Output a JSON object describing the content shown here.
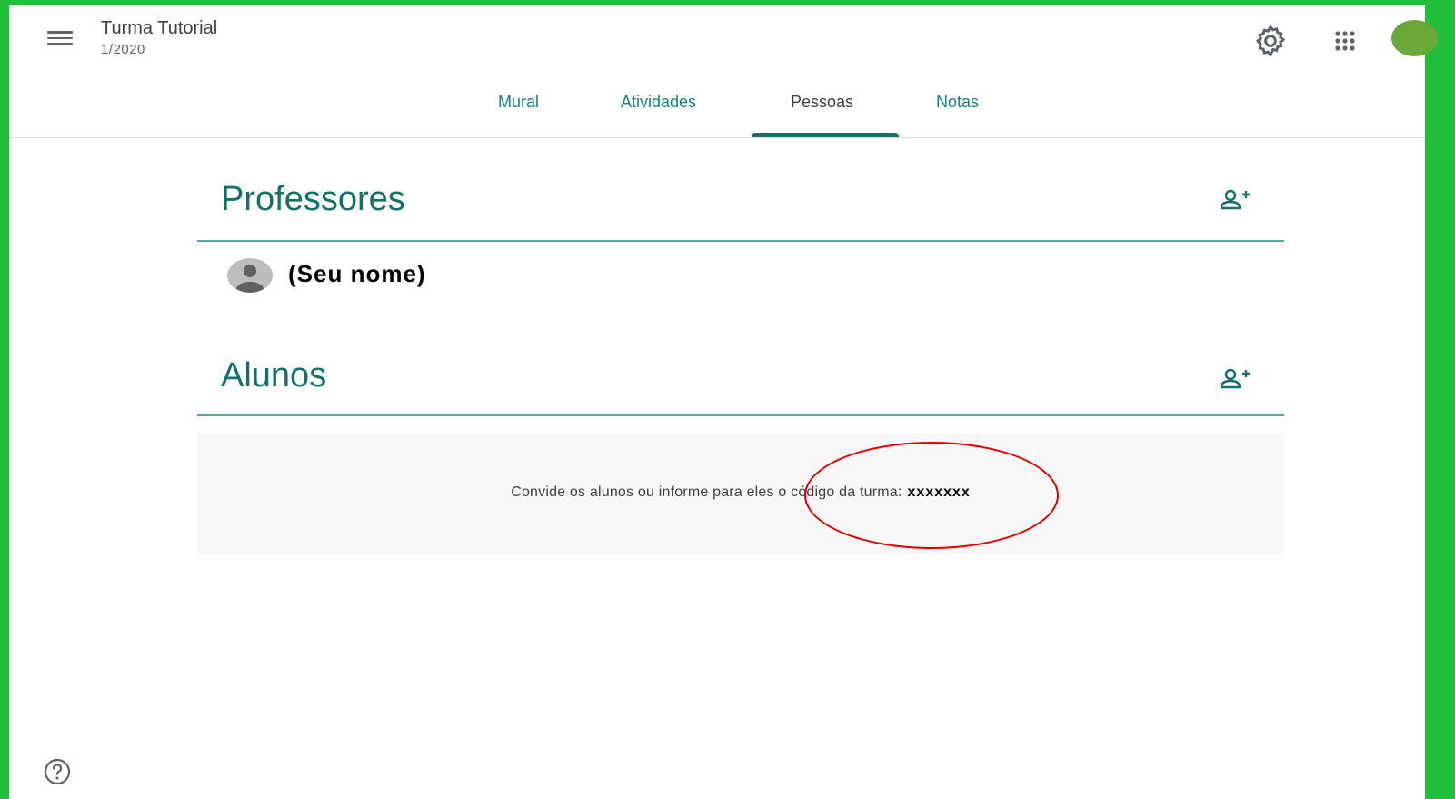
{
  "header": {
    "class_name": "Turma Tutorial",
    "class_period": "1/2020",
    "icons": {
      "menu": "hamburger-menu-icon",
      "settings": "gear-icon",
      "apps": "apps-grid-icon",
      "account": "account-avatar"
    },
    "avatar_color": "#6aa938"
  },
  "tabs": [
    {
      "label": "Mural",
      "active": false
    },
    {
      "label": "Atividades",
      "active": false
    },
    {
      "label": "Pessoas",
      "active": true
    },
    {
      "label": "Notas",
      "active": false
    }
  ],
  "sections": {
    "teachers": {
      "title": "Professores",
      "members": [
        {
          "name": "(Seu nome)"
        }
      ],
      "add_icon": "add-person-icon"
    },
    "students": {
      "title": "Alunos",
      "add_icon": "add-person-icon",
      "invite_message": "Convide os alunos ou informe para eles o código da turma:",
      "class_code": "xxxxxxx"
    }
  },
  "footer": {
    "help_icon": "help-circle-icon"
  },
  "colors": {
    "frame_green": "#1fbf3a",
    "accent_teal": "#137268",
    "highlight_red": "#e00000"
  }
}
